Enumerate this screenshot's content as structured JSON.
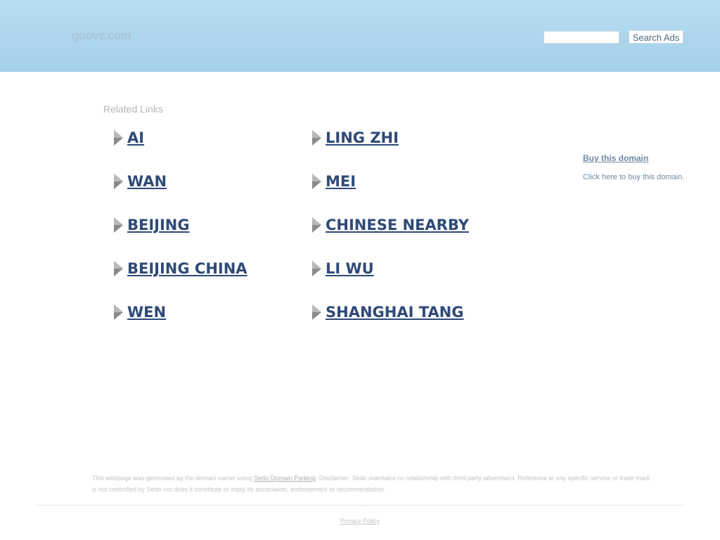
{
  "header": {
    "logo": "guovz.com",
    "search_button_label": "Search Ads",
    "search_input_value": "",
    "search_input_placeholder": ""
  },
  "related": {
    "title": "Related Links",
    "left_links": [
      "AI",
      "WAN",
      "BEIJING",
      "BEIJING CHINA",
      "WEN"
    ],
    "right_links": [
      "LING ZHI",
      "MEI",
      "CHINESE NEARBY",
      "LI WU",
      "SHANGHAI TANG"
    ]
  },
  "sidebar": {
    "buy_link": "Buy this domain",
    "buy_text": "Click here to buy this domain."
  },
  "footer": {
    "disclaimer_before": "This webpage was generated by the domain owner using ",
    "disclaimer_link": "Sedo Domain Parking",
    "disclaimer_after": ". Disclaimer: Sedo maintains no relationship with third party advertisers. Reference to any specific service or trade mark is not controlled by Sedo nor does it constitute or imply its association, endorsement or recommendation.",
    "privacy_label": "Privacy Policy"
  },
  "colors": {
    "header_bg": "#b7ddf2",
    "link": "#2f4a78",
    "muted": "#c4c4c4"
  }
}
